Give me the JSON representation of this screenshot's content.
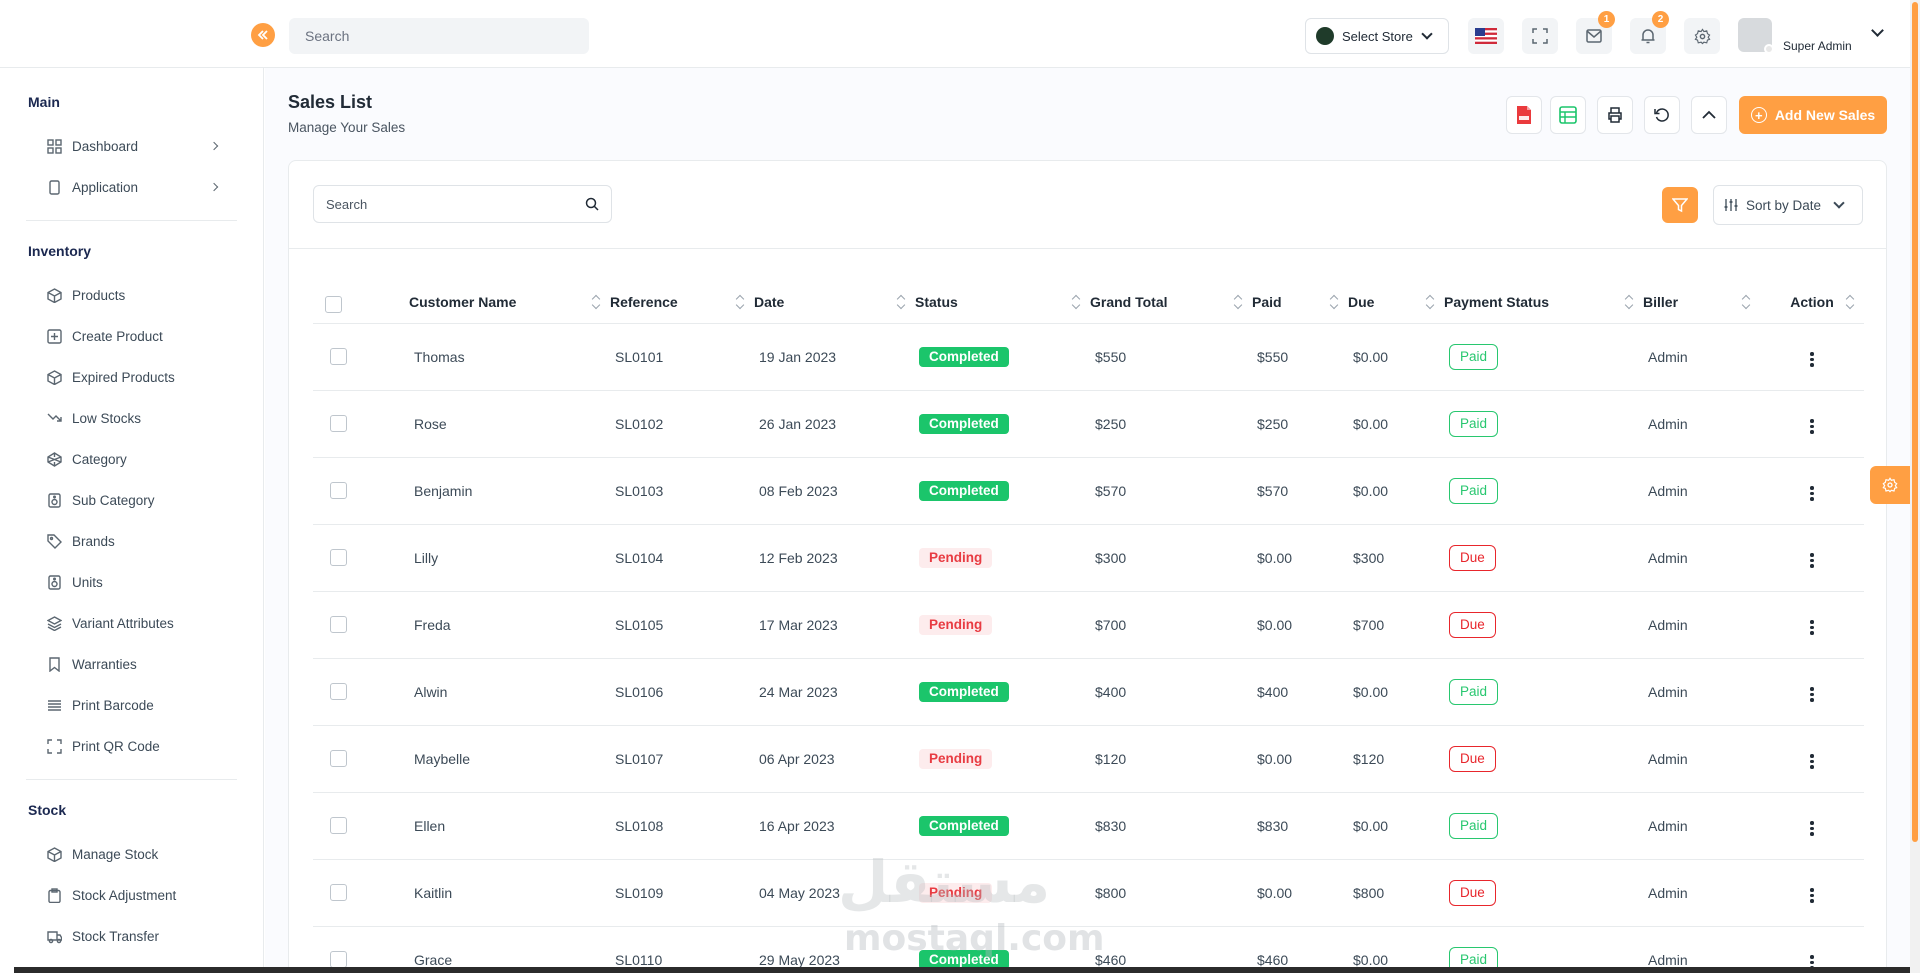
{
  "header": {
    "search_placeholder": "Search",
    "store_label": "Select Store",
    "mail_badge": "1",
    "notif_badge": "2",
    "user_role": "Super Admin"
  },
  "sidebar": {
    "sections": [
      {
        "title": "Main",
        "items": [
          {
            "label": "Dashboard",
            "icon": "grid-icon",
            "arrow": true
          },
          {
            "label": "Application",
            "icon": "phone-icon",
            "arrow": true
          }
        ]
      },
      {
        "title": "Inventory",
        "items": [
          {
            "label": "Products",
            "icon": "box-icon"
          },
          {
            "label": "Create Product",
            "icon": "plus-square-icon"
          },
          {
            "label": "Expired Products",
            "icon": "box-icon"
          },
          {
            "label": "Low Stocks",
            "icon": "trending-down-icon"
          },
          {
            "label": "Category",
            "icon": "codepen-icon"
          },
          {
            "label": "Sub Category",
            "icon": "speaker-icon"
          },
          {
            "label": "Brands",
            "icon": "tag-icon"
          },
          {
            "label": "Units",
            "icon": "speaker-icon"
          },
          {
            "label": "Variant Attributes",
            "icon": "layers-icon"
          },
          {
            "label": "Warranties",
            "icon": "bookmark-icon"
          },
          {
            "label": "Print Barcode",
            "icon": "align-justify-icon"
          },
          {
            "label": "Print QR Code",
            "icon": "maximize-icon"
          }
        ]
      },
      {
        "title": "Stock",
        "items": [
          {
            "label": "Manage Stock",
            "icon": "box-icon"
          },
          {
            "label": "Stock Adjustment",
            "icon": "clipboard-icon"
          },
          {
            "label": "Stock Transfer",
            "icon": "truck-icon"
          }
        ]
      }
    ]
  },
  "page": {
    "title": "Sales List",
    "subtitle": "Manage Your Sales",
    "add_button": "Add New Sales"
  },
  "filters": {
    "search_placeholder": "Search",
    "sort_label": "Sort by Date"
  },
  "table": {
    "columns": [
      "Customer Name",
      "Reference",
      "Date",
      "Status",
      "Grand Total",
      "Paid",
      "Due",
      "Payment Status",
      "Biller",
      "Action"
    ],
    "rows": [
      {
        "customer": "Thomas",
        "reference": "SL0101",
        "date": "19 Jan 2023",
        "status": "Completed",
        "total": "$550",
        "paid": "$550",
        "due": "$0.00",
        "payment": "Paid",
        "biller": "Admin"
      },
      {
        "customer": "Rose",
        "reference": "SL0102",
        "date": "26 Jan 2023",
        "status": "Completed",
        "total": "$250",
        "paid": "$250",
        "due": "$0.00",
        "payment": "Paid",
        "biller": "Admin"
      },
      {
        "customer": "Benjamin",
        "reference": "SL0103",
        "date": "08 Feb 2023",
        "status": "Completed",
        "total": "$570",
        "paid": "$570",
        "due": "$0.00",
        "payment": "Paid",
        "biller": "Admin"
      },
      {
        "customer": "Lilly",
        "reference": "SL0104",
        "date": "12 Feb 2023",
        "status": "Pending",
        "total": "$300",
        "paid": "$0.00",
        "due": "$300",
        "payment": "Due",
        "biller": "Admin"
      },
      {
        "customer": "Freda",
        "reference": "SL0105",
        "date": "17 Mar 2023",
        "status": "Pending",
        "total": "$700",
        "paid": "$0.00",
        "due": "$700",
        "payment": "Due",
        "biller": "Admin"
      },
      {
        "customer": "Alwin",
        "reference": "SL0106",
        "date": "24 Mar 2023",
        "status": "Completed",
        "total": "$400",
        "paid": "$400",
        "due": "$0.00",
        "payment": "Paid",
        "biller": "Admin"
      },
      {
        "customer": "Maybelle",
        "reference": "SL0107",
        "date": "06 Apr 2023",
        "status": "Pending",
        "total": "$120",
        "paid": "$0.00",
        "due": "$120",
        "payment": "Due",
        "biller": "Admin"
      },
      {
        "customer": "Ellen",
        "reference": "SL0108",
        "date": "16 Apr 2023",
        "status": "Completed",
        "total": "$830",
        "paid": "$830",
        "due": "$0.00",
        "payment": "Paid",
        "biller": "Admin"
      },
      {
        "customer": "Kaitlin",
        "reference": "SL0109",
        "date": "04 May 2023",
        "status": "Pending",
        "total": "$800",
        "paid": "$0.00",
        "due": "$800",
        "payment": "Due",
        "biller": "Admin"
      },
      {
        "customer": "Grace",
        "reference": "SL0110",
        "date": "29 May 2023",
        "status": "Completed",
        "total": "$460",
        "paid": "$460",
        "due": "$0.00",
        "payment": "Paid",
        "biller": "Admin"
      }
    ]
  },
  "watermark": {
    "arabic": "مستقل",
    "latin": "mostaql.com"
  },
  "colors": {
    "accent": "#ff9f43",
    "completed": "#1bc56b",
    "pending_text": "#e83b42",
    "paid": "#28c76f",
    "due": "#e8262c"
  }
}
